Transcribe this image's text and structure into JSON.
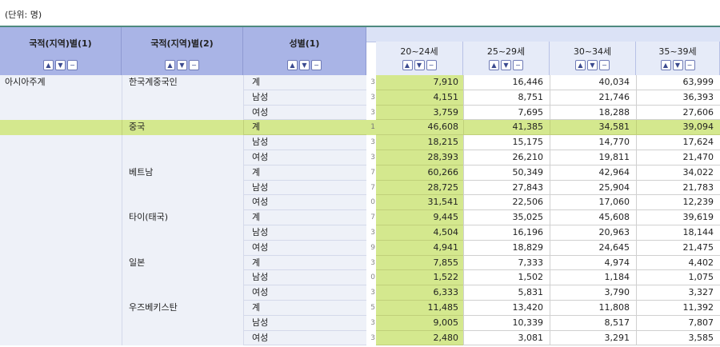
{
  "unit_label": "(단위: 명)",
  "headers": {
    "dim1": "국적(지역)별(1)",
    "dim2": "국적(지역)별(2)",
    "dim3": "성별(1)",
    "age_cols": [
      "20~24세",
      "25~29세",
      "30~34세",
      "35~39세"
    ]
  },
  "control_icons": [
    "caret-up-icon",
    "caret-down-icon",
    "minus-icon"
  ],
  "rows": [
    {
      "c1": "아시아주계",
      "c2": "한국계중국인",
      "c3": "계",
      "frag": "3",
      "v": [
        "7,910",
        "16,446",
        "40,034",
        "63,999"
      ]
    },
    {
      "c1": "",
      "c2": "",
      "c3": "남성",
      "frag": "3",
      "v": [
        "4,151",
        "8,751",
        "21,746",
        "36,393"
      ]
    },
    {
      "c1": "",
      "c2": "",
      "c3": "여성",
      "frag": "3",
      "v": [
        "3,759",
        "7,695",
        "18,288",
        "27,606"
      ]
    },
    {
      "c1": "",
      "c2": "중국",
      "c3": "계",
      "frag": "1",
      "v": [
        "46,608",
        "41,385",
        "34,581",
        "39,094"
      ],
      "highlight": true
    },
    {
      "c1": "",
      "c2": "",
      "c3": "남성",
      "frag": "3",
      "v": [
        "18,215",
        "15,175",
        "14,770",
        "17,624"
      ]
    },
    {
      "c1": "",
      "c2": "",
      "c3": "여성",
      "frag": "3",
      "v": [
        "28,393",
        "26,210",
        "19,811",
        "21,470"
      ]
    },
    {
      "c1": "",
      "c2": "베트남",
      "c3": "계",
      "frag": "7",
      "v": [
        "60,266",
        "50,349",
        "42,964",
        "34,022"
      ]
    },
    {
      "c1": "",
      "c2": "",
      "c3": "남성",
      "frag": "7",
      "v": [
        "28,725",
        "27,843",
        "25,904",
        "21,783"
      ]
    },
    {
      "c1": "",
      "c2": "",
      "c3": "여성",
      "frag": "0",
      "v": [
        "31,541",
        "22,506",
        "17,060",
        "12,239"
      ]
    },
    {
      "c1": "",
      "c2": "타이(태국)",
      "c3": "계",
      "frag": "7",
      "v": [
        "9,445",
        "35,025",
        "45,608",
        "39,619"
      ]
    },
    {
      "c1": "",
      "c2": "",
      "c3": "남성",
      "frag": "3",
      "v": [
        "4,504",
        "16,196",
        "20,963",
        "18,144"
      ]
    },
    {
      "c1": "",
      "c2": "",
      "c3": "여성",
      "frag": "9",
      "v": [
        "4,941",
        "18,829",
        "24,645",
        "21,475"
      ]
    },
    {
      "c1": "",
      "c2": "일본",
      "c3": "계",
      "frag": "3",
      "v": [
        "7,855",
        "7,333",
        "4,974",
        "4,402"
      ]
    },
    {
      "c1": "",
      "c2": "",
      "c3": "남성",
      "frag": "0",
      "v": [
        "1,522",
        "1,502",
        "1,184",
        "1,075"
      ]
    },
    {
      "c1": "",
      "c2": "",
      "c3": "여성",
      "frag": "3",
      "v": [
        "6,333",
        "5,831",
        "3,790",
        "3,327"
      ]
    },
    {
      "c1": "",
      "c2": "우즈베키스탄",
      "c3": "계",
      "frag": "5",
      "v": [
        "11,485",
        "13,420",
        "11,808",
        "11,392"
      ]
    },
    {
      "c1": "",
      "c2": "",
      "c3": "남성",
      "frag": "3",
      "v": [
        "9,005",
        "10,339",
        "8,517",
        "7,807"
      ]
    },
    {
      "c1": "",
      "c2": "",
      "c3": "여성",
      "frag": "3",
      "v": [
        "2,480",
        "3,081",
        "3,291",
        "3,585"
      ]
    }
  ]
}
